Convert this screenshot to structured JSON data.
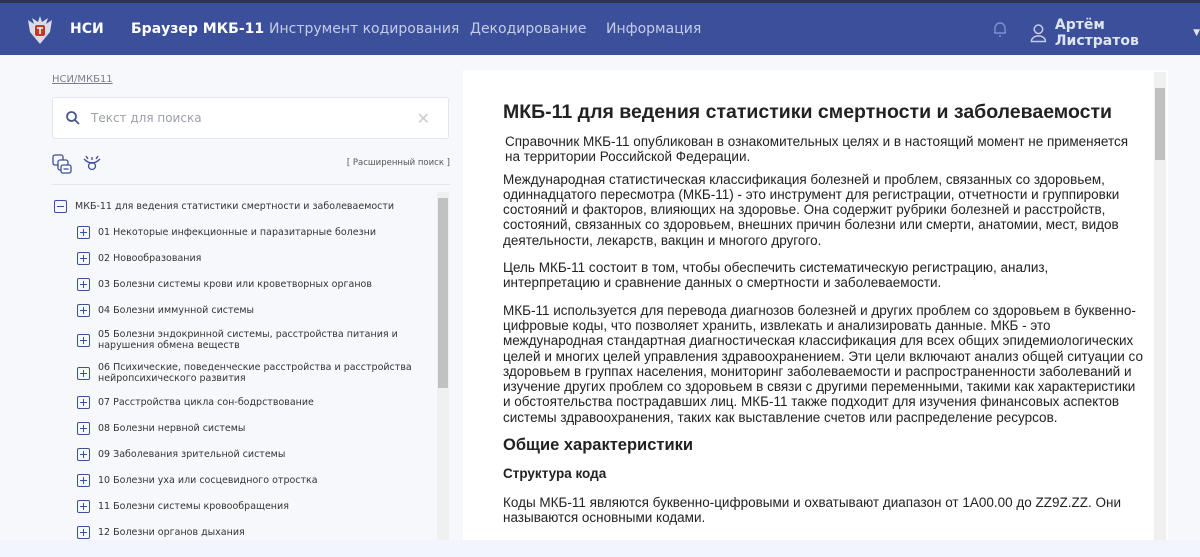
{
  "header": {
    "brand": "НСИ",
    "nav": [
      "Браузер МКБ-11",
      "Инструмент кодирования",
      "Декодирование",
      "Информация"
    ],
    "user": "Артём Листратов"
  },
  "sidebar": {
    "breadcrumb": "НСИ/МКБ11",
    "search_placeholder": "Текст для поиска",
    "advanced_search": "[ Расширенный поиск ]",
    "root": "МКБ-11 для ведения статистики смертности и заболеваемости",
    "items": [
      "01 Некоторые инфекционные и паразитарные болезни",
      "02 Новообразования",
      "03 Болезни системы крови или кроветворных органов",
      "04 Болезни иммунной системы",
      "05 Болезни эндокринной системы, расстройства питания и нарушения обмена веществ",
      "06 Психические, поведенческие расстройства и расстройства нейропсихического развития",
      "07 Расстройства цикла сон-бодрствование",
      "08 Болезни нервной системы",
      "09 Заболевания зрительной системы",
      "10 Болезни уха или сосцевидного отростка",
      "11 Болезни системы кровообращения",
      "12 Болезни органов дыхания"
    ]
  },
  "main": {
    "title": "МКБ-11 для ведения статистики смертности и заболеваемости",
    "note": "Справочник МКБ-11 опубликован в ознакомительных целях и в настоящий момент не применяется на территории Российской Федерации.",
    "p1": "Международная статистическая классификация болезней и проблем, связанных со здоровьем, одиннадцатого пересмотра (МКБ-11) - это инструмент для регистрации, отчетности и группировки состояний и факторов, влияющих на здоровье. Она содержит рубрики болезней и расстройств, состояний, связанных со здоровьем, внешних причин болезни или смерти, анатомии, мест, видов деятельности, лекарств, вакцин и многого другого.",
    "p2": "Цель МКБ-11 состоит в том, чтобы обеспечить систематическую регистрацию, анализ, интерпретацию и сравнение данных о смертности и заболеваемости.",
    "p3": "МКБ-11 используется для перевода диагнозов болезней и других проблем со здоровьем в буквенно-цифровые коды, что позволяет хранить, извлекать и анализировать данные. МКБ - это международная стандартная диагностическая классификация для всех общих эпидемиологических целей и многих целей управления здравоохранением. Эти цели включают анализ общей ситуации со здоровьем в группах населения, мониторинг заболеваемости и распространенности заболеваний и изучение других проблем со здоровьем в связи с другими переменными, такими как характеристики и обстоятельства пострадавших лиц. МКБ-11 также подходит для изучения финансовых аспектов системы здравоохранения, таких как выставление счетов или распределение ресурсов.",
    "h2": "Общие характеристики",
    "h3": "Структура кода",
    "p4": "Коды МКБ-11 являются буквенно-цифровыми и охватывают диапазон от 1A00.00 до ZZ9Z.ZZ. Они называются основными кодами."
  }
}
